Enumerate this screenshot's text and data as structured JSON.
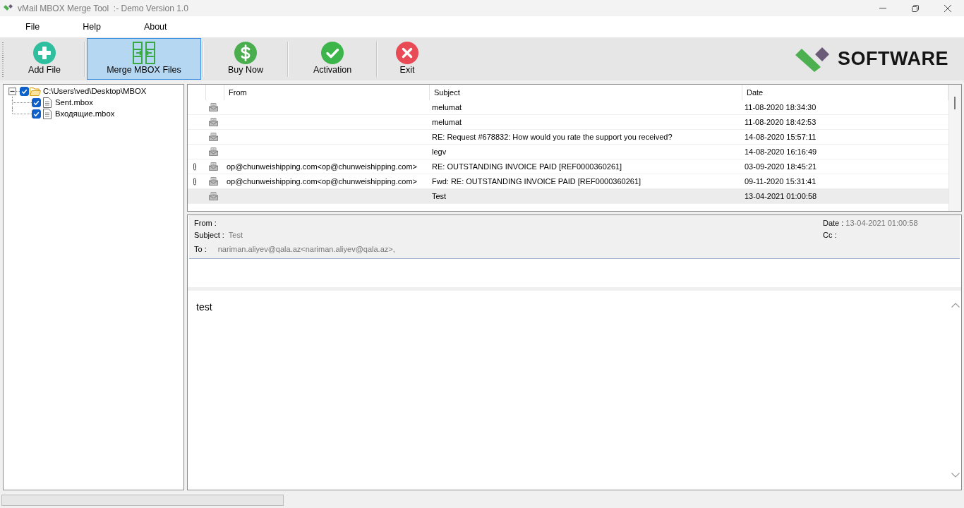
{
  "window": {
    "title": "vMail MBOX Merge Tool  :- Demo Version 1.0"
  },
  "menu": [
    "File",
    "Help",
    "About"
  ],
  "toolbar": [
    {
      "label": "Add File",
      "kind": "add",
      "selected": false
    },
    {
      "label": "Merge MBOX Files",
      "kind": "merge",
      "selected": true
    },
    {
      "label": "Buy Now",
      "kind": "buy",
      "selected": false
    },
    {
      "label": "Activation",
      "kind": "activate",
      "selected": false
    },
    {
      "label": "Exit",
      "kind": "exit",
      "selected": false
    }
  ],
  "brand": {
    "text": "SOFTWARE"
  },
  "tree": [
    {
      "label": "C:\\Users\\ved\\Desktop\\MBOX",
      "kind": "folder",
      "checked": true,
      "expanded": true,
      "children": [
        {
          "label": "Sent.mbox",
          "kind": "file",
          "checked": true
        },
        {
          "label": "Входящие.mbox",
          "kind": "file",
          "checked": true
        }
      ]
    }
  ],
  "message_list": {
    "columns": [
      "From",
      "Subject",
      "Date"
    ],
    "rows": [
      {
        "attachment": false,
        "subject": "melumat",
        "date": "11-08-2020 18:34:30",
        "selected": false
      },
      {
        "attachment": false,
        "subject": "melumat",
        "date": "11-08-2020 18:42:53",
        "selected": false
      },
      {
        "attachment": false,
        "subject": "RE: Request #678832: How would you rate the support you received?",
        "date": "14-08-2020 15:57:11",
        "selected": false
      },
      {
        "attachment": false,
        "subject": "legv",
        "date": "14-08-2020 16:16:49",
        "selected": false
      },
      {
        "attachment": true,
        "from": "op@chunweishipping.com<op@chunweishipping.com>",
        "subject": "RE: OUTSTANDING INVOICE PAID [REF0000360261]",
        "date": "03-09-2020 18:45:21",
        "selected": false
      },
      {
        "attachment": true,
        "from": "op@chunweishipping.com<op@chunweishipping.com>",
        "subject": "Fwd: RE: OUTSTANDING INVOICE PAID [REF0000360261]",
        "date": "09-11-2020 15:31:41",
        "selected": false
      },
      {
        "attachment": false,
        "subject": "Test",
        "date": "13-04-2021 01:00:58",
        "selected": true
      }
    ]
  },
  "preview": {
    "fields_left": [
      {
        "label": "From :"
      },
      {
        "label": "Subject :",
        "value": "Test"
      },
      {
        "label": "To :",
        "value": "nariman.aliyev@qala.az<nariman.aliyev@qala.az>,"
      }
    ],
    "fields_right": [
      {
        "label": "Date :",
        "value": "13-04-2021 01:00:58"
      },
      {
        "label": "Cc :"
      }
    ],
    "body": "test"
  },
  "status_bar": {
    "progress": {
      "level": 0
    }
  }
}
